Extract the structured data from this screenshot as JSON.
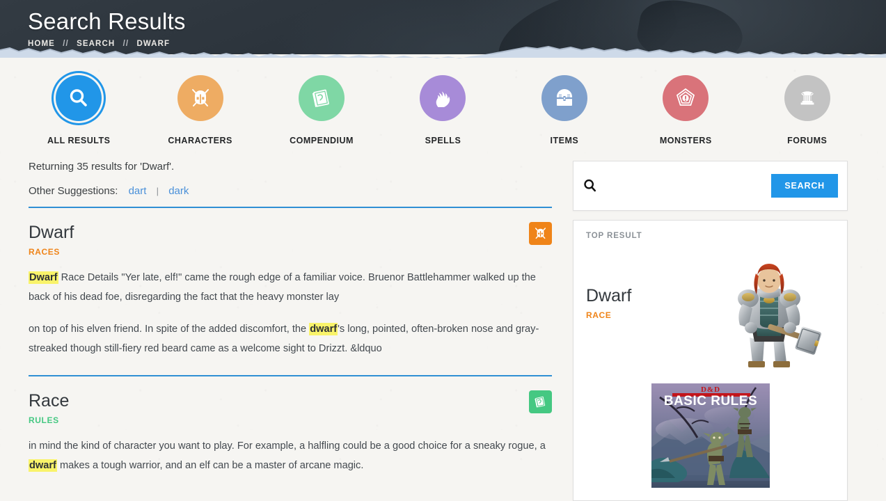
{
  "header": {
    "title": "Search Results",
    "breadcrumb": [
      {
        "label": "HOME"
      },
      {
        "label": "SEARCH"
      },
      {
        "label": "DWARF"
      }
    ],
    "separator": "//"
  },
  "categories": [
    {
      "label": "ALL RESULTS",
      "icon": "search-icon",
      "color": "#2196e8",
      "active": true
    },
    {
      "label": "CHARACTERS",
      "icon": "helmet-swords-icon",
      "color": "#eeac63",
      "active": false
    },
    {
      "label": "COMPENDIUM",
      "icon": "book-icon",
      "color": "#7fd7a5",
      "active": false
    },
    {
      "label": "SPELLS",
      "icon": "flame-hand-icon",
      "color": "#a78bd8",
      "active": false
    },
    {
      "label": "ITEMS",
      "icon": "treasure-chest-icon",
      "color": "#7fa0cc",
      "active": false
    },
    {
      "label": "MONSTERS",
      "icon": "monster-eye-icon",
      "color": "#d9737a",
      "active": false
    },
    {
      "label": "FORUMS",
      "icon": "column-icon",
      "color": "#c3c3c3",
      "active": false
    }
  ],
  "results_summary": "Returning 35 results for 'Dwarf'.",
  "suggestions": {
    "label": "Other Suggestions:",
    "items": [
      "dart",
      "dark"
    ],
    "divider": "|"
  },
  "results": [
    {
      "title": "Dwarf",
      "category": "RACES",
      "category_class": "races",
      "badge_icon": "helmet-swords-icon",
      "badge_color": "#ef8419",
      "paragraphs": [
        [
          {
            "text": "Dwarf",
            "highlight": true
          },
          {
            "text": " Race Details \"Yer late, elf!\" came the rough edge of a familiar voice. Bruenor Battlehammer walked up the back of his dead foe, disregarding the fact that the heavy monster lay",
            "highlight": false
          }
        ],
        [
          {
            "text": "on top of his elven friend. In spite of the added discomfort, the ",
            "highlight": false
          },
          {
            "text": "dwarf",
            "highlight": true
          },
          {
            "text": "'s long, pointed, often-broken nose and gray-streaked though still-fiery red beard came as a welcome sight to Drizzt. &ldquo",
            "highlight": false
          }
        ]
      ]
    },
    {
      "title": "Race",
      "category": "RULES",
      "category_class": "rules",
      "badge_icon": "book-icon",
      "badge_color": "#45c882",
      "paragraphs": [
        [
          {
            "text": "in mind the kind of character you want to play. For example, a halfling could be a good choice for a sneaky rogue, a ",
            "highlight": false
          },
          {
            "text": "dwarf",
            "highlight": true
          },
          {
            "text": " makes a tough warrior, and an elf can be a master of arcane magic.",
            "highlight": false
          }
        ]
      ]
    }
  ],
  "sidebar": {
    "search": {
      "value": "",
      "placeholder": "",
      "icon": "search-icon",
      "button_label": "SEARCH",
      "button_color": "#2196e8"
    },
    "top_result": {
      "label": "TOP RESULT",
      "title": "Dwarf",
      "category": "RACE",
      "category_color": "#ef8419",
      "art_alt": "dwarf-warrior-illustration",
      "book": {
        "brand": "D&D",
        "title": "BASIC RULES",
        "alt": "dnd-basic-rules-cover"
      }
    }
  }
}
